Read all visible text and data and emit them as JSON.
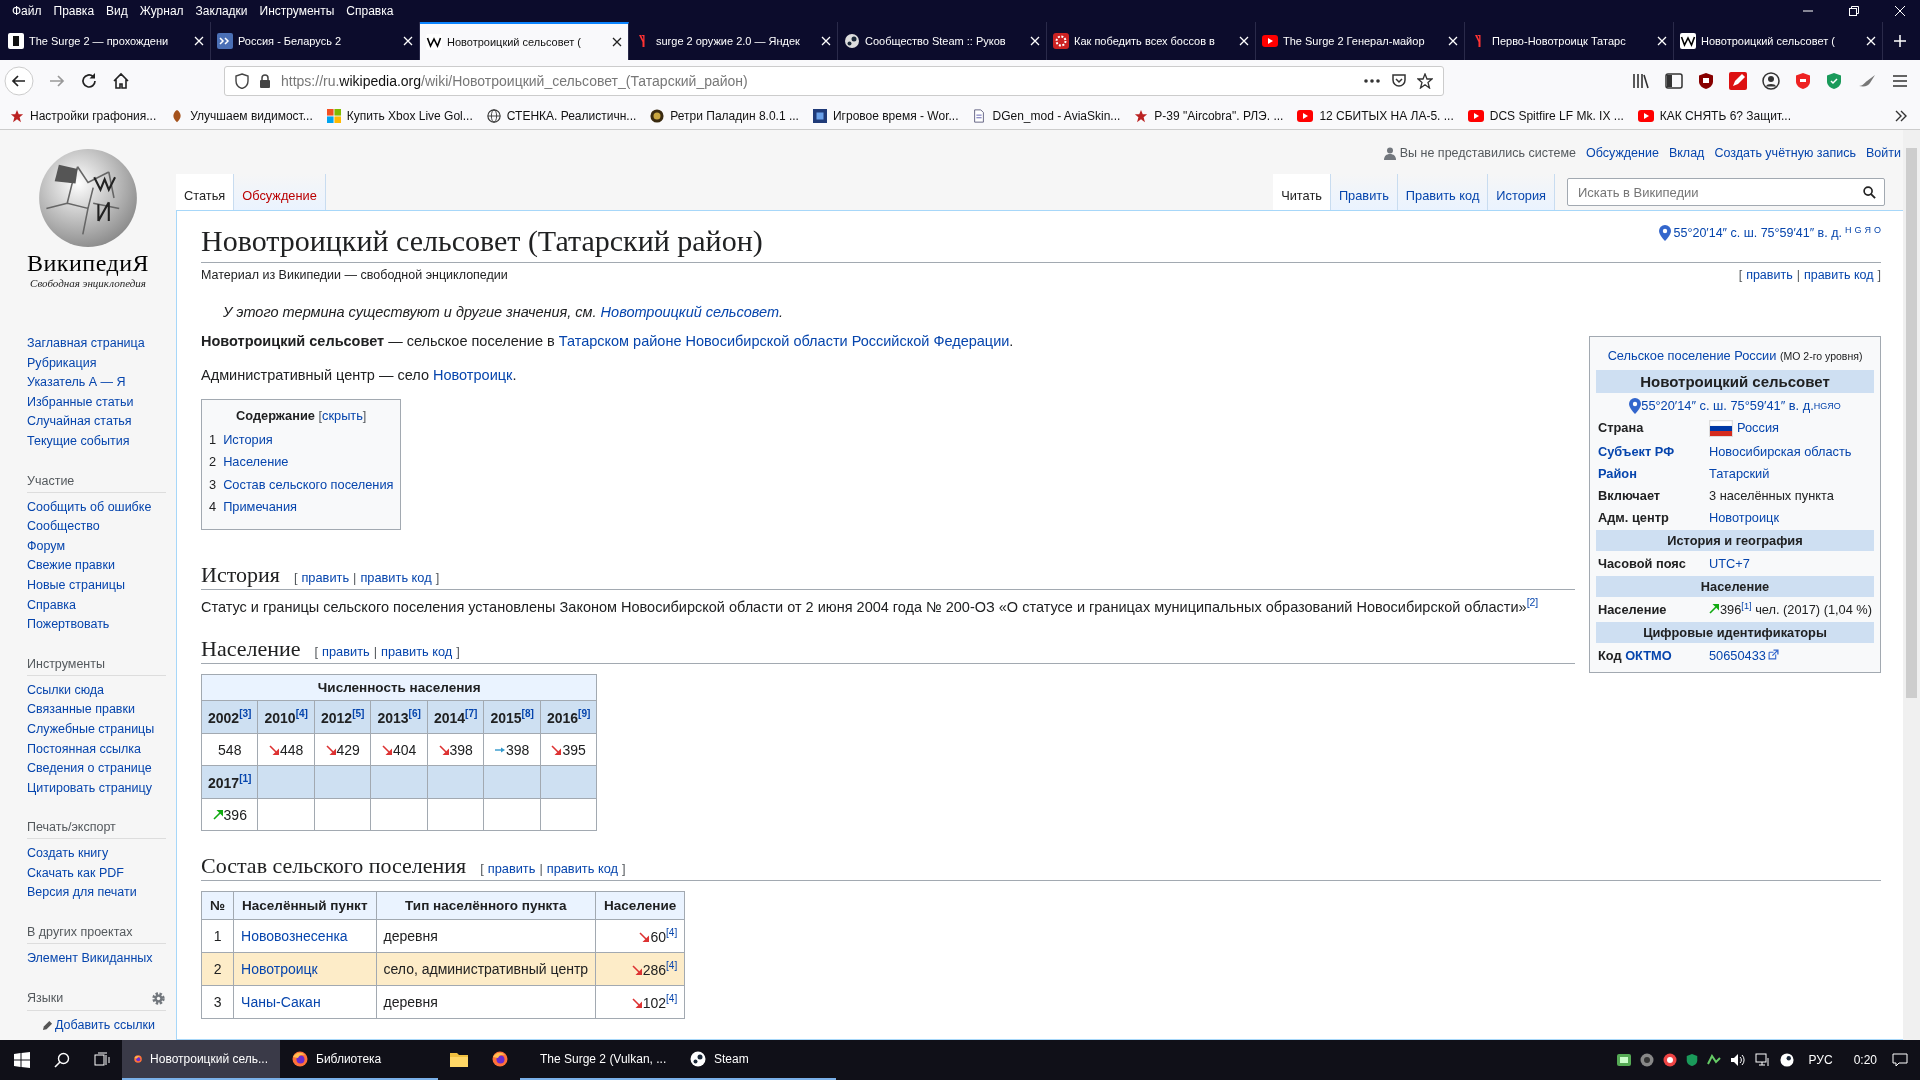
{
  "menu": [
    "Файл",
    "Правка",
    "Вид",
    "Журнал",
    "Закладки",
    "Инструменты",
    "Справка"
  ],
  "browser_tabs": [
    {
      "title": "The Surge 2 — прохождени",
      "kind": "surge",
      "selected": false
    },
    {
      "title": "Россия - Беларусь 2",
      "kind": "blue",
      "selected": false
    },
    {
      "title": "Новотроицкий сельсовет (",
      "kind": "wiki",
      "selected": true
    },
    {
      "title": "surge 2 оружие 2.0 — Яндек",
      "kind": "yandex",
      "selected": false
    },
    {
      "title": "Сообщество Steam :: Руков",
      "kind": "steam",
      "selected": false
    },
    {
      "title": "Как победить всех боссов в",
      "kind": "gear",
      "selected": false
    },
    {
      "title": "The Surge 2 Генерал-майор",
      "kind": "youtube",
      "selected": false
    },
    {
      "title": "Перво-Новотроицк Татарс",
      "kind": "yandex",
      "selected": false
    },
    {
      "title": "Новотроицкий сельсовет (",
      "kind": "wiki",
      "selected": false
    }
  ],
  "address": "https://ru.**wikipedia.org**/wiki/Новотроицкий_сельсовет_(Татарский_район)",
  "bookmarks": [
    {
      "title": "Настройки графония...",
      "kind": "star"
    },
    {
      "title": "Улучшаем видимост...",
      "kind": "leaf"
    },
    {
      "title": "Купить Xbox Live Gol...",
      "kind": "windows"
    },
    {
      "title": "СТЕНКА. Реалистичн...",
      "kind": "globe"
    },
    {
      "title": "Ретри Паладин 8.0.1 ...",
      "kind": "round"
    },
    {
      "title": "Игровое время - Wor...",
      "kind": "square"
    },
    {
      "title": "DGen_mod - AviaSkin...",
      "kind": "page"
    },
    {
      "title": "Р-39 \"Aircobra\". РЛЭ. ...",
      "kind": "star"
    },
    {
      "title": "12 СБИТЫХ НА ЛА-5. ...",
      "kind": "youtube"
    },
    {
      "title": "DCS Spitfire LF Mk. IX ...",
      "kind": "youtube"
    },
    {
      "title": "КАК СНЯТЬ 6? Защит...",
      "kind": "youtube"
    }
  ],
  "wiki": {
    "logo": {
      "name": "ВикипедиЯ",
      "tagline": "Свободная энциклопедия"
    },
    "nav": [
      {
        "items": [
          "Заглавная страница",
          "Рубрикация",
          "Указатель А — Я",
          "Избранные статьи",
          "Случайная статья",
          "Текущие события"
        ]
      },
      {
        "heading": "Участие",
        "items": [
          "Сообщить об ошибке",
          "Сообщество",
          "Форум",
          "Свежие правки",
          "Новые страницы",
          "Справка",
          "Пожертвовать"
        ]
      },
      {
        "heading": "Инструменты",
        "items": [
          "Ссылки сюда",
          "Связанные правки",
          "Служебные страницы",
          "Постоянная ссылка",
          "Сведения о странице",
          "Цитировать страницу"
        ]
      },
      {
        "heading": "Печать/экспорт",
        "items": [
          "Создать книгу",
          "Скачать как PDF",
          "Версия для печати"
        ]
      },
      {
        "heading": "В других проектах",
        "items": [
          "Элемент Викиданных"
        ]
      }
    ],
    "languages": {
      "heading": "Языки",
      "add_link": "Добавить ссылки"
    },
    "personal": {
      "notice": "Вы не представились системе",
      "links": [
        "Обсуждение",
        "Вклад",
        "Создать учётную запись",
        "Войти"
      ]
    },
    "namespaces": [
      {
        "label": "Статья",
        "selected": true,
        "new": false
      },
      {
        "label": "Обсуждение",
        "selected": false,
        "new": true
      }
    ],
    "views": [
      {
        "label": "Читать",
        "selected": true
      },
      {
        "label": "Править",
        "selected": false
      },
      {
        "label": "Править код",
        "selected": false
      },
      {
        "label": "История",
        "selected": false
      }
    ],
    "search": {
      "placeholder": "Искать в Википедии"
    },
    "title": "Новотроицкий сельсовет (Татарский район)",
    "coords": {
      "text": "55°20′14″ с. ш. 75°59′41″ в. д.",
      "services": [
        "H",
        "G",
        "Я",
        "O"
      ]
    },
    "subtitle": "Материал из Википедии — свободной энциклопедии",
    "edit_links": {
      "open": "[",
      "links": [
        "править",
        "править код"
      ],
      "separator": "|",
      "close": "]"
    },
    "hatnote": [
      {
        "kind": "text",
        "text": "У этого термина существуют и другие значения, см. "
      },
      {
        "kind": "link",
        "text": "Новотроицкий сельсовет"
      },
      {
        "kind": "text",
        "text": "."
      }
    ],
    "lead": [
      [
        {
          "kind": "bold",
          "text": "Новотроицкий сельсовет"
        },
        {
          "kind": "text",
          "text": " — сельское поселение в "
        },
        {
          "kind": "link",
          "text": "Татарском районе Новосибирской области Российской Федерации"
        },
        {
          "kind": "text",
          "text": "."
        }
      ],
      [
        {
          "kind": "text",
          "text": "Административный центр — село "
        },
        {
          "kind": "link",
          "text": "Новотроицк"
        },
        {
          "kind": "text",
          "text": "."
        }
      ]
    ],
    "toc": {
      "title": "Содержание",
      "toggle": {
        "open": "[",
        "label": "скрыть",
        "close": "]"
      },
      "items": [
        {
          "num": "1",
          "label": "История"
        },
        {
          "num": "2",
          "label": "Население"
        },
        {
          "num": "3",
          "label": "Состав сельского поселения"
        },
        {
          "num": "4",
          "label": "Примечания"
        }
      ]
    },
    "infobox": {
      "category": "Сельское поселение России",
      "category_note": "(МО 2-го уровня)",
      "title": "Новотроицкий сельсовет",
      "coords": {
        "text": "55°20′14″ с. ш. 75°59′41″ в. д.",
        "services": [
          "H",
          "G",
          "Я",
          "O"
        ]
      },
      "rows": [
        {
          "kind": "row",
          "label": [
            {
              "kind": "text",
              "text": "Страна"
            }
          ],
          "value": [
            {
              "kind": "flag"
            },
            {
              "kind": "link",
              "text": "Россия"
            }
          ]
        },
        {
          "kind": "row",
          "label": [
            {
              "kind": "link",
              "text": "Субъект РФ"
            }
          ],
          "value": [
            {
              "kind": "link",
              "text": "Новосибирская область"
            }
          ]
        },
        {
          "kind": "row",
          "label": [
            {
              "kind": "link",
              "text": "Район"
            }
          ],
          "value": [
            {
              "kind": "link",
              "text": "Татарский"
            }
          ]
        },
        {
          "kind": "row",
          "label": [
            {
              "kind": "text",
              "text": "Включает"
            }
          ],
          "value": [
            {
              "kind": "text",
              "text": "3 населённых пункта"
            }
          ]
        },
        {
          "kind": "row",
          "label": [
            {
              "kind": "text",
              "text": "Адм. центр"
            }
          ],
          "value": [
            {
              "kind": "link",
              "text": "Новотроицк"
            }
          ]
        },
        {
          "kind": "header",
          "label": [
            {
              "kind": "text",
              "text": "История и география"
            }
          ]
        },
        {
          "kind": "row",
          "label": [
            {
              "kind": "text",
              "text": "Часовой пояс"
            }
          ],
          "value": [
            {
              "kind": "link",
              "text": "UTC+7"
            }
          ]
        },
        {
          "kind": "header",
          "label": [
            {
              "kind": "text",
              "text": "Население"
            }
          ]
        },
        {
          "kind": "row",
          "label": [
            {
              "kind": "text",
              "text": "Население"
            }
          ],
          "value": [
            {
              "kind": "trend-up"
            },
            {
              "kind": "text",
              "text": "396"
            },
            {
              "kind": "ref",
              "text": "[1]"
            },
            {
              "kind": "text",
              "text": " чел. (2017) (1,04 %)"
            }
          ]
        },
        {
          "kind": "header",
          "label": [
            {
              "kind": "text",
              "text": "Цифровые идентификаторы"
            }
          ]
        },
        {
          "kind": "row",
          "label": [
            {
              "kind": "text",
              "text": "Код "
            },
            {
              "kind": "link",
              "text": "ОКТМО"
            }
          ],
          "value": [
            {
              "kind": "link",
              "text": "50650433"
            },
            {
              "kind": "external"
            }
          ]
        }
      ]
    },
    "sections": [
      {
        "kind": "text",
        "heading": "История",
        "edit_links": {
          "open": "[",
          "links": [
            "править",
            "править код"
          ],
          "separator": "|",
          "close": "]"
        },
        "paragraph": [
          {
            "kind": "text",
            "text": "Статус и границы сельского поселения установлены Законом Новосибирской области от 2 июня 2004 года № 200-ОЗ «О статусе и границах муниципальных образований Новосибирской области»"
          },
          {
            "kind": "ref",
            "text": "[2]"
          }
        ]
      },
      {
        "kind": "population",
        "heading": "Население",
        "edit_links": {
          "open": "[",
          "links": [
            "править",
            "править код"
          ],
          "separator": "|",
          "close": "]"
        },
        "caption": "Численность населения",
        "rows": [
          {
            "years": [
              {
                "year": "2002",
                "ref": "[3]"
              },
              {
                "year": "2010",
                "ref": "[4]"
              },
              {
                "year": "2012",
                "ref": "[5]"
              },
              {
                "year": "2013",
                "ref": "[6]"
              },
              {
                "year": "2014",
                "ref": "[7]"
              },
              {
                "year": "2015",
                "ref": "[8]"
              },
              {
                "year": "2016",
                "ref": "[9]"
              }
            ],
            "values": [
              {
                "value": "548",
                "kind": "plain"
              },
              {
                "value": "448",
                "kind": "down"
              },
              {
                "value": "429",
                "kind": "down"
              },
              {
                "value": "404",
                "kind": "down"
              },
              {
                "value": "398",
                "kind": "down"
              },
              {
                "value": "398",
                "kind": "flat"
              },
              {
                "value": "395",
                "kind": "down"
              }
            ]
          },
          {
            "years": [
              {
                "year": "2017",
                "ref": "[1]"
              }
            ],
            "values": [
              {
                "value": "396",
                "kind": "up"
              }
            ]
          }
        ]
      },
      {
        "kind": "composition",
        "heading": "Состав сельского поселения",
        "edit_links": {
          "open": "[",
          "links": [
            "править",
            "править код"
          ],
          "separator": "|",
          "close": "]"
        },
        "columns": [
          "№",
          "Населённый пункт",
          "Тип населённого пункта",
          "Население"
        ],
        "rows": [
          {
            "num": "1",
            "name": "Нововознесенка",
            "type": "деревня",
            "population": "60",
            "kind": "down",
            "ref": "[4]",
            "highlighted": false
          },
          {
            "num": "2",
            "name": "Новотроицк",
            "type": "село, административный центр",
            "population": "286",
            "kind": "down",
            "ref": "[4]",
            "highlighted": true
          },
          {
            "num": "3",
            "name": "Чаны-Сакан",
            "type": "деревня",
            "population": "102",
            "kind": "down",
            "ref": "[4]",
            "highlighted": false
          }
        ]
      }
    ]
  },
  "taskbar": {
    "apps": [
      {
        "title": "Новотроицкий сель...",
        "kind": "firefox",
        "running": true,
        "selected": true
      },
      {
        "title": "Библиотека",
        "kind": "firefox",
        "running": true,
        "selected": false
      },
      {
        "kind": "folder",
        "running": false,
        "selected": false
      },
      {
        "kind": "firefox",
        "running": false,
        "selected": false
      },
      {
        "title": "The Surge 2 (Vulkan, ...",
        "kind": "surge",
        "running": true,
        "selected": false
      },
      {
        "title": "Steam",
        "kind": "steam",
        "running": true,
        "selected": false
      }
    ],
    "language": "РУС",
    "time": "0:20"
  }
}
